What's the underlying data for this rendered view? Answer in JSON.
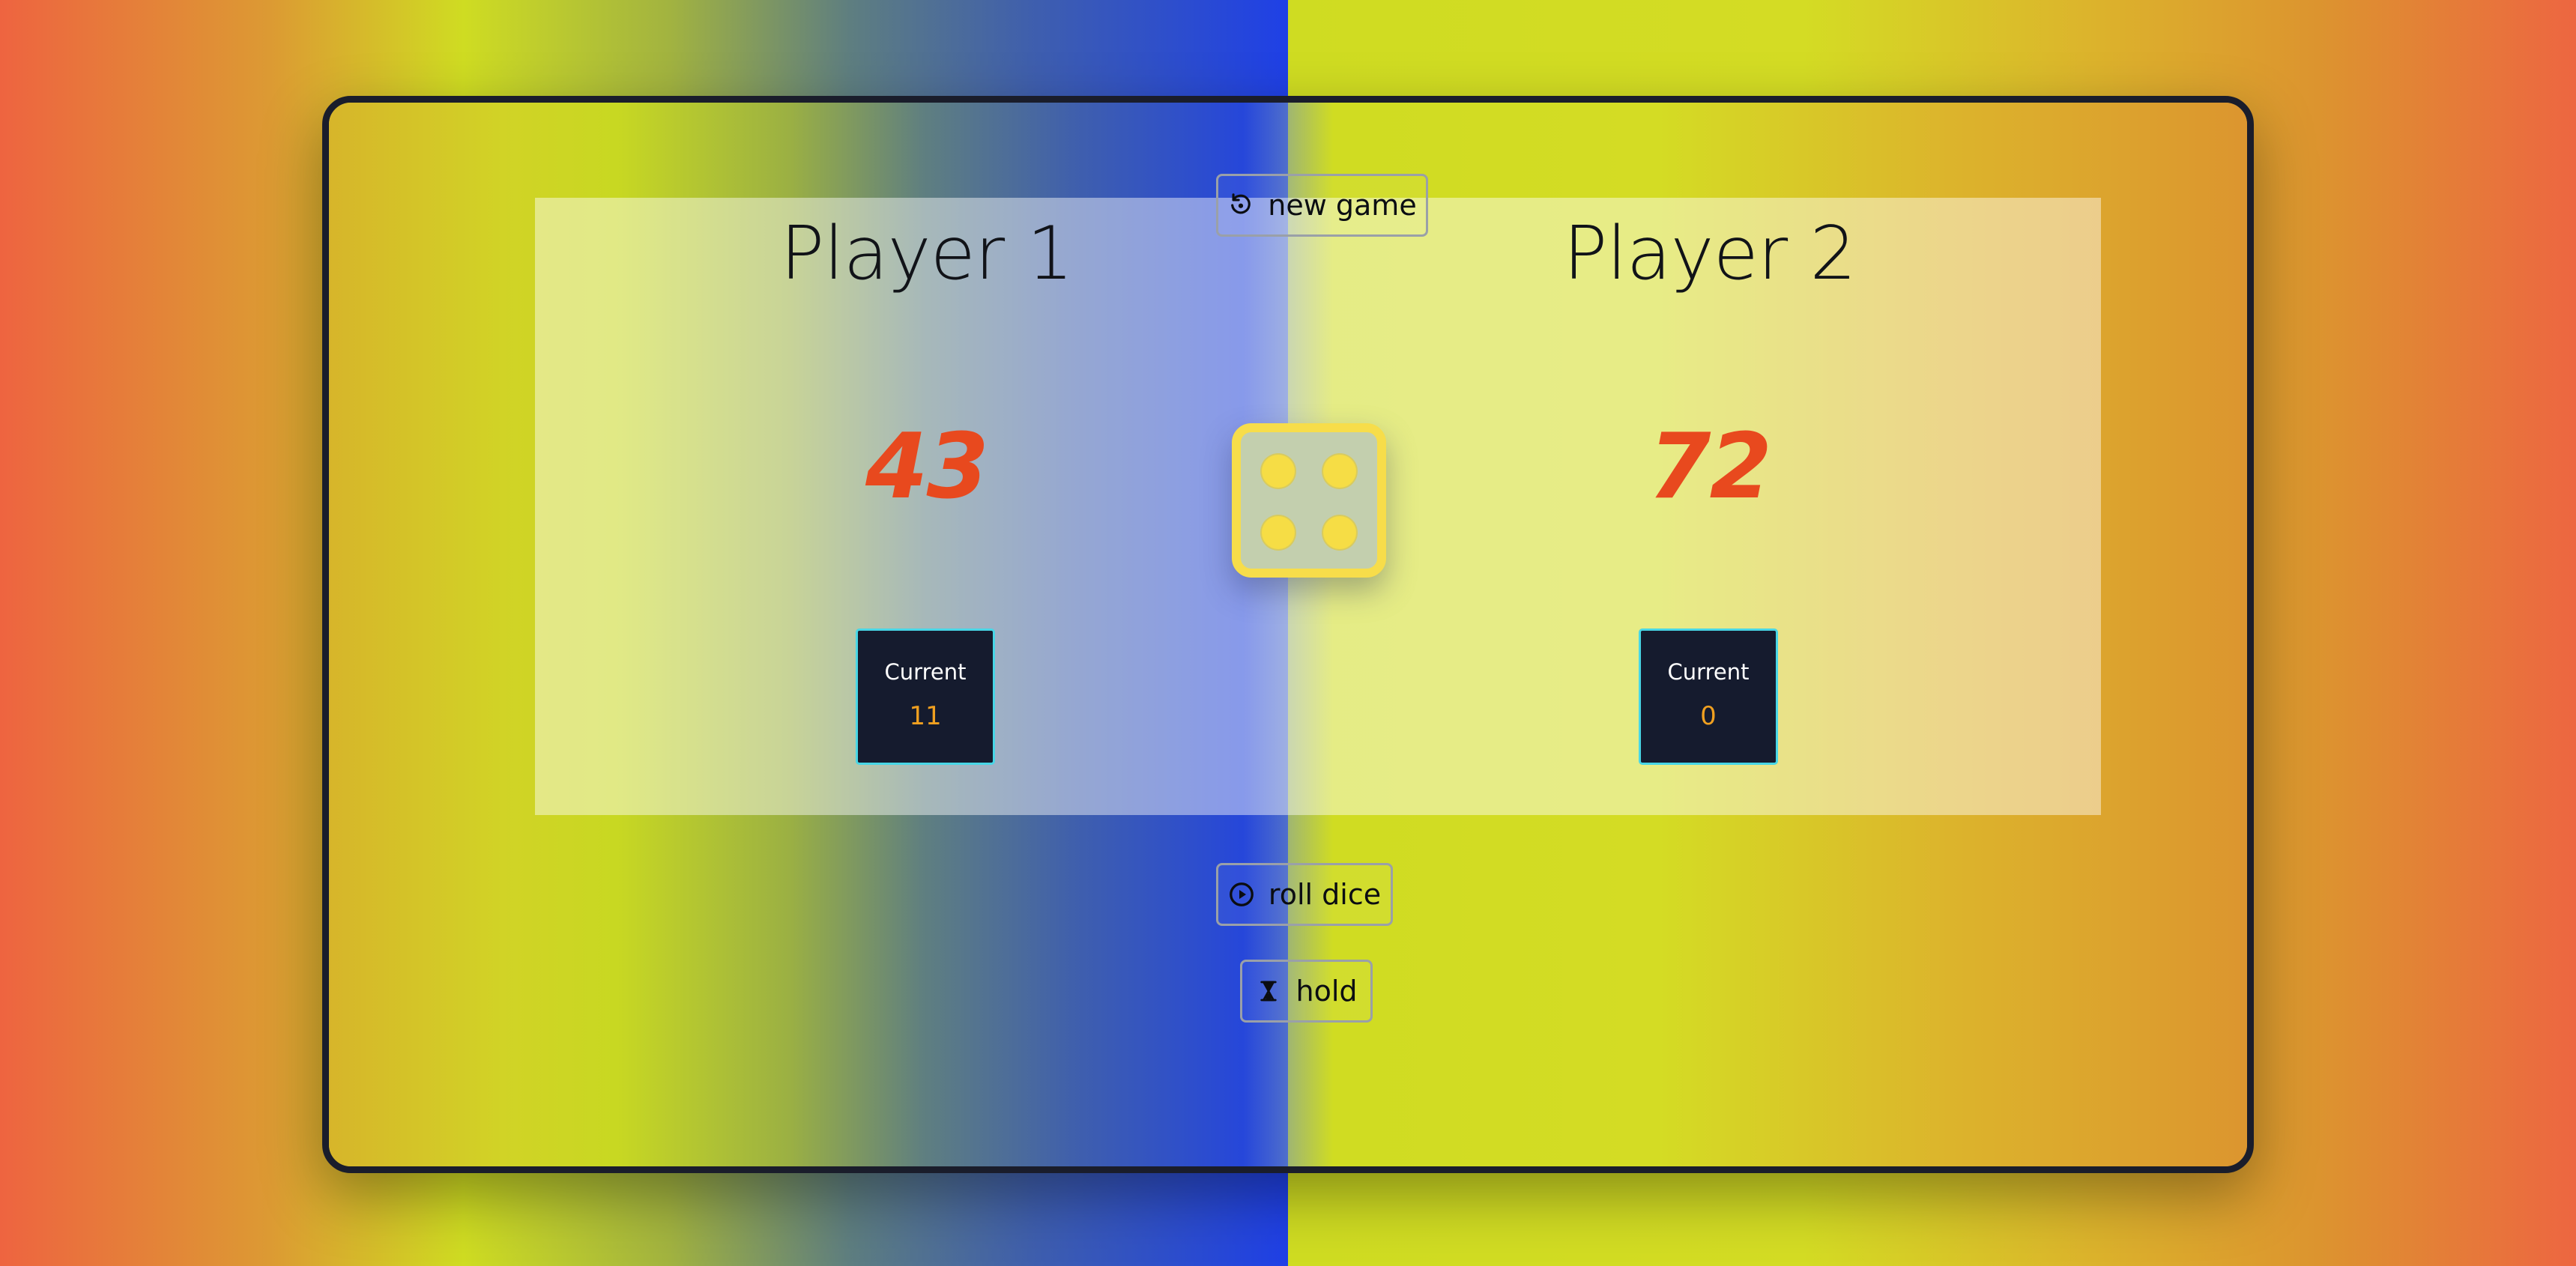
{
  "controls": {
    "new_game_label": "new game",
    "roll_dice_label": "roll dice",
    "hold_label": "hold"
  },
  "players": [
    {
      "name": "Player 1",
      "score": "43",
      "current_label": "Current",
      "current_value": "11"
    },
    {
      "name": "Player 2",
      "score": "72",
      "current_label": "Current",
      "current_value": "0"
    }
  ],
  "dice": {
    "value": 4
  },
  "icons": {
    "new_game": "restart-icon",
    "roll_dice": "play-circle-icon",
    "hold": "hourglass-icon"
  },
  "colors": {
    "score": "#e8491e",
    "current_value": "#f0a020",
    "current_box_bg": "#151b2e",
    "current_box_border": "#48d6e6",
    "dice_border": "#f7dd4a",
    "frame_border": "#1a1d2b"
  }
}
